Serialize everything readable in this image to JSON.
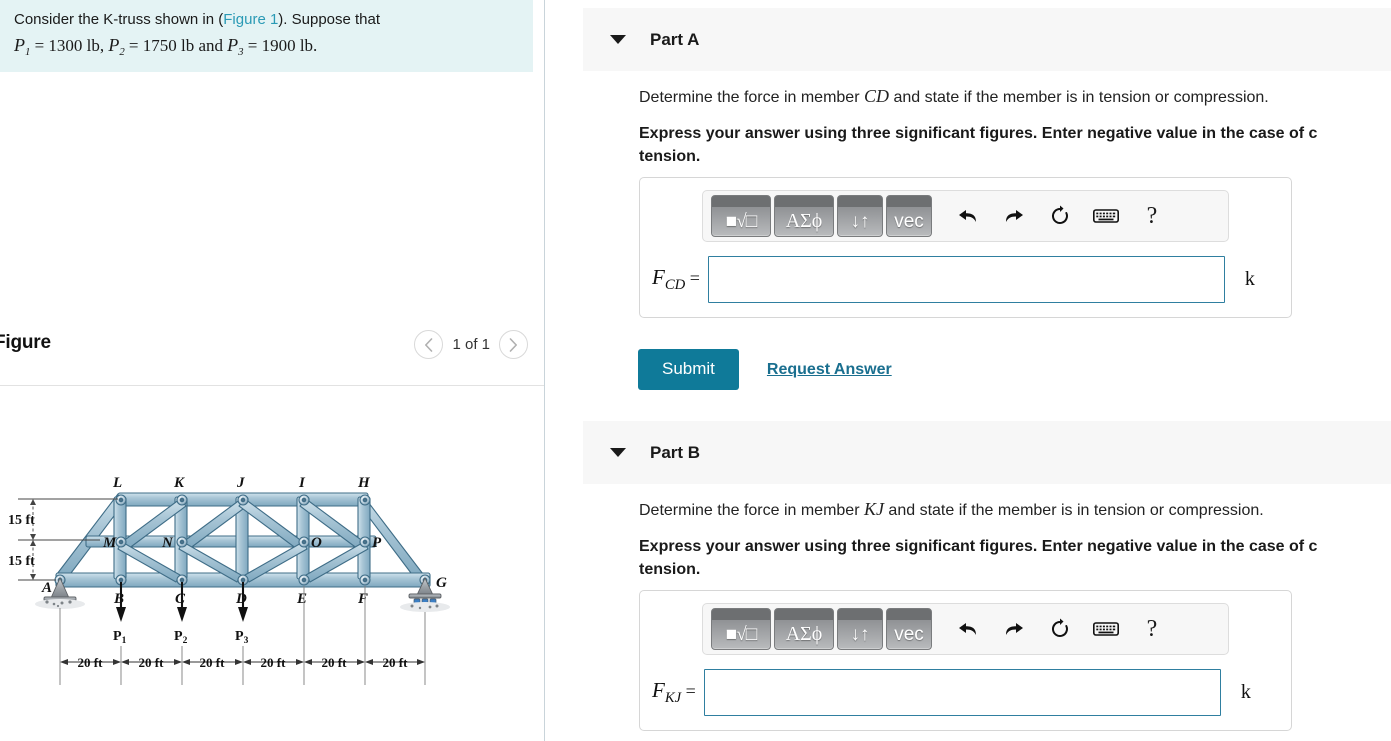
{
  "problem": {
    "line1_pre": "Consider the K-truss shown in (",
    "figure_link": "Figure 1",
    "line1_post": "). Suppose that",
    "p1_sym": "P",
    "p1_sub": "1",
    "p1_val": "= 1300 lb,",
    "p2_sym": "P",
    "p2_sub": "2",
    "p2_val": "= 1750 lb and",
    "p3_sym": "P",
    "p3_sub": "3",
    "p3_val": "= 1900 lb."
  },
  "figure": {
    "title": "Figure",
    "counter": "1 of 1",
    "prev_icon": "chevron-left-icon",
    "next_icon": "chevron-right-icon",
    "joints_top": [
      "L",
      "K",
      "J",
      "I",
      "H"
    ],
    "joints_mid": [
      "M",
      "N",
      "O",
      "P"
    ],
    "joints_bottom": [
      "A",
      "B",
      "C",
      "D",
      "E",
      "F",
      "G"
    ],
    "loads": [
      {
        "label": "P",
        "sub": "1"
      },
      {
        "label": "P",
        "sub": "2"
      },
      {
        "label": "P",
        "sub": "3"
      }
    ],
    "height_dims": [
      "15 ft",
      "15 ft"
    ],
    "span_dims": [
      "20 ft",
      "20 ft",
      "20 ft",
      "20 ft",
      "20 ft",
      "20 ft"
    ],
    "member_color": "#a9c6d6",
    "member_edge": "#4c7a93",
    "support_color": "#8e9296"
  },
  "parts": [
    {
      "id": "A",
      "title": "Part A",
      "caret_icon": "caret-down-icon",
      "question": "Determine the force in member ",
      "member": "CD",
      "question_tail": " and state if the member is in tension or compression.",
      "instruction": "Express your answer using three significant figures. Enter negative value in the case of c",
      "instruction_line2": "tension.",
      "answer_symbol": "F",
      "answer_sub": "CD",
      "answer_value": "",
      "answer_placeholder": "",
      "unit": "k",
      "submit_label": "Submit",
      "request_label": "Request Answer"
    },
    {
      "id": "B",
      "title": "Part B",
      "caret_icon": "caret-down-icon",
      "question": "Determine the force in member ",
      "member": "KJ",
      "question_tail": " and state if the member is in tension or compression.",
      "instruction": "Express your answer using three significant figures. Enter negative value in the case of c",
      "instruction_line2": "tension.",
      "answer_symbol": "F",
      "answer_sub": "KJ",
      "answer_value": "",
      "answer_placeholder": "",
      "unit": "k"
    }
  ],
  "mathbar": {
    "buttons": [
      {
        "name": "template-sqrt-button",
        "glyph": "■√□"
      },
      {
        "name": "greek-symbols-button",
        "glyph": "ΑΣϕ"
      },
      {
        "name": "arrows-button",
        "glyph": "↓↑"
      },
      {
        "name": "vector-button",
        "glyph": "vec"
      },
      {
        "name": "undo-button",
        "glyph": "undo-arrow-icon"
      },
      {
        "name": "redo-button",
        "glyph": "redo-arrow-icon"
      },
      {
        "name": "reset-button",
        "glyph": "refresh-icon"
      },
      {
        "name": "keyboard-button",
        "glyph": "keyboard-icon"
      },
      {
        "name": "help-button",
        "glyph": "?"
      }
    ]
  },
  "colors": {
    "banner_bg": "#e4f3f4",
    "part_header_bg": "#f7f7f7",
    "submit_bg": "#0f7a99",
    "link": "#1a6f8f",
    "figure_link": "#2a9ab5",
    "input_border": "#2f7fa0"
  }
}
